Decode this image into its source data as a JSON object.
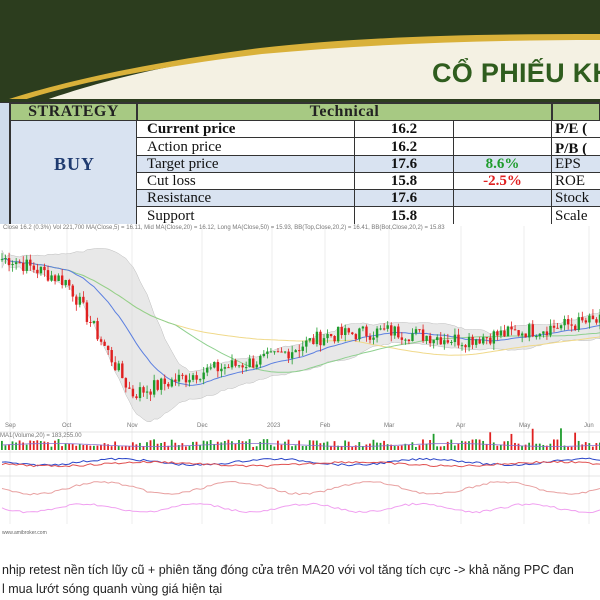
{
  "banner": {
    "title": "CỔ PHIẾU KH",
    "colors": {
      "dark": "#2c3d1e",
      "gold": "#d9b13a",
      "light": "#f4f1e3",
      "title": "#2f5d1e"
    }
  },
  "table": {
    "header_strategy": "STRATEGY",
    "header_technical": "Technical",
    "recommendation": "BUY",
    "rows": [
      {
        "label": "Current price",
        "value": "16.2",
        "pct": "",
        "right": "P/E ("
      },
      {
        "label": "Action price",
        "value": "16.2",
        "pct": "",
        "right": "P/B ("
      },
      {
        "label": "Target price",
        "value": "17.6",
        "pct": "8.6%",
        "right": "EPS"
      },
      {
        "label": "Cut loss",
        "value": "15.8",
        "pct": "-2.5%",
        "right": "ROE"
      },
      {
        "label": "Resistance",
        "value": "17.6",
        "pct": "",
        "right": "Stock"
      },
      {
        "label": "Support",
        "value": "15.8",
        "pct": "",
        "right": "Scale"
      }
    ],
    "colors": {
      "header": "#a7c983",
      "shade": "#d9e3f1",
      "positive": "#1e9c2c",
      "negative": "#e02020"
    }
  },
  "chart": {
    "legend_text": "Close 16.2 (0.3%) Vol 221,700 MA(Close,5) = 16.11, Mid MA(Close,20) = 16.12, Long MA(Close,50) = 15.93, BB(Top,Close,20,2) = 16.41, BB(Bot,Close,20,2) = 15.83",
    "volume_legend": "MA1(Volume,20) = 183,255.00",
    "month_labels": [
      "Sep",
      "Oct",
      "Nov",
      "Dec",
      "2023",
      "Feb",
      "Mar",
      "Apr",
      "May",
      "Jun"
    ],
    "site_label": "www.amibroker.com"
  },
  "chart_data": {
    "type": "line",
    "x": [
      "Sep",
      "Oct",
      "Nov",
      "Dec",
      "2023",
      "Feb",
      "Mar",
      "Apr",
      "May",
      "Jun"
    ],
    "series": [
      {
        "name": "Close",
        "values": [
          17.6,
          17.1,
          14.6,
          15.1,
          15.4,
          15.9,
          16.0,
          15.8,
          16.0,
          16.2
        ]
      }
    ],
    "title": "",
    "xlabel": "",
    "ylabel": ""
  },
  "commentary": {
    "line1": "nhịp retest nền tích lũy cũ + phiên tăng đóng cửa trên MA20 với vol tăng tích cực -> khả năng PPC đan",
    "line2": "l mua lướt sóng quanh vùng giá hiện tại"
  }
}
